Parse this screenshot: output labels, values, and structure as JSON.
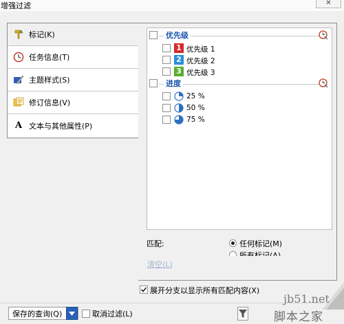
{
  "window": {
    "title": "增强过滤",
    "close_label": "✕"
  },
  "sidebar": {
    "tabs": [
      {
        "label": "标记(K)",
        "icon": "marker-icon"
      },
      {
        "label": "任务信息(T)",
        "icon": "clock-icon"
      },
      {
        "label": "主题样式(S)",
        "icon": "brush-icon"
      },
      {
        "label": "修订信息(V)",
        "icon": "notes-icon"
      },
      {
        "label": "文本与其他属性(P)",
        "icon": "text-a-icon",
        "glyph": "A"
      }
    ]
  },
  "marker_list": {
    "groups": [
      {
        "label": "优先级",
        "items": [
          {
            "badge": "1",
            "label": "优先级 1",
            "color": "#d62b2b"
          },
          {
            "badge": "2",
            "label": "优先级 2",
            "color": "#2d8fd8"
          },
          {
            "badge": "3",
            "label": "优先级 3",
            "color": "#58ae2e"
          }
        ]
      },
      {
        "label": "进度",
        "items": [
          {
            "label": "25 %",
            "progress": 0.25
          },
          {
            "label": "50 %",
            "progress": 0.5
          },
          {
            "label": "75 %",
            "progress": 0.75
          }
        ]
      }
    ]
  },
  "match": {
    "label": "匹配:",
    "options": [
      {
        "label": "任何标记(M)",
        "selected": true
      },
      {
        "label": "所有标记(A)",
        "selected": false
      }
    ]
  },
  "clear_label": "清空(L)",
  "expand_option": {
    "label": "展开分支以显示所有匹配内容(X)",
    "checked": true
  },
  "footer": {
    "saved_query_label": "保存的查询(Q)",
    "cancel_filter_label": "取消过滤(L)",
    "cancel_filter_checked": false
  },
  "watermark": {
    "line1": "jb51.net",
    "line2": "脚本之家"
  },
  "colors": {
    "accent": "#2a62b6",
    "group_title": "#1a56b0"
  }
}
